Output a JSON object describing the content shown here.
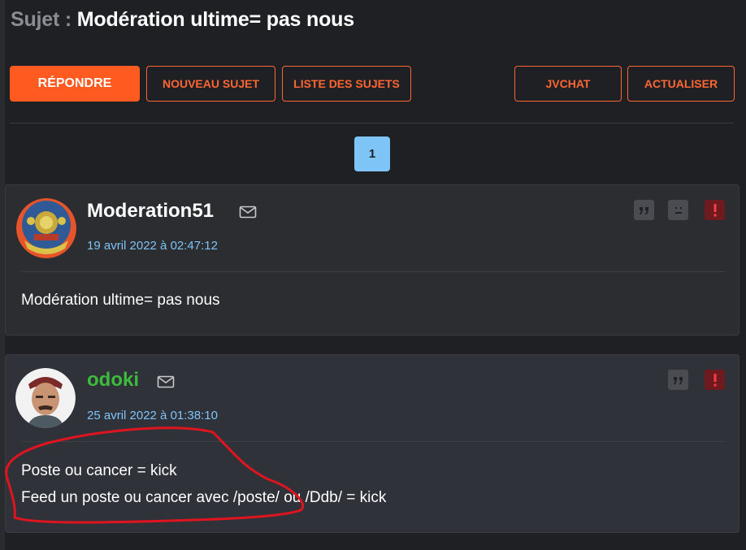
{
  "topic": {
    "prefix": "Sujet :",
    "title": "Modération ultime= pas nous"
  },
  "toolbar": {
    "reply": "RÉPONDRE",
    "new_topic": "NOUVEAU SUJET",
    "topic_list": "LISTE DES SUJETS",
    "jvchat": "JVCHAT",
    "refresh": "ACTUALISER"
  },
  "pagination": {
    "current": "1"
  },
  "posts": [
    {
      "author": "Moderation51",
      "date": "19 avril 2022 à 02:47:12",
      "lines": [
        "Modération ultime= pas nous"
      ],
      "actions": [
        "quote-icon",
        "sad-face-icon",
        "report-icon"
      ]
    },
    {
      "author": "odoki",
      "date": "25 avril 2022 à 01:38:10",
      "lines": [
        "Poste ou cancer = kick",
        "Feed un poste ou cancer avec /poste/ ou /Ddb/ = kick"
      ],
      "actions": [
        "quote-icon",
        "report-icon"
      ]
    }
  ],
  "colors": {
    "background": "#1f2023",
    "accent": "#ff5a1f",
    "link_blue": "#7ec4f7",
    "author_green": "#3dbb3d",
    "annotation_red": "#e0141e"
  }
}
